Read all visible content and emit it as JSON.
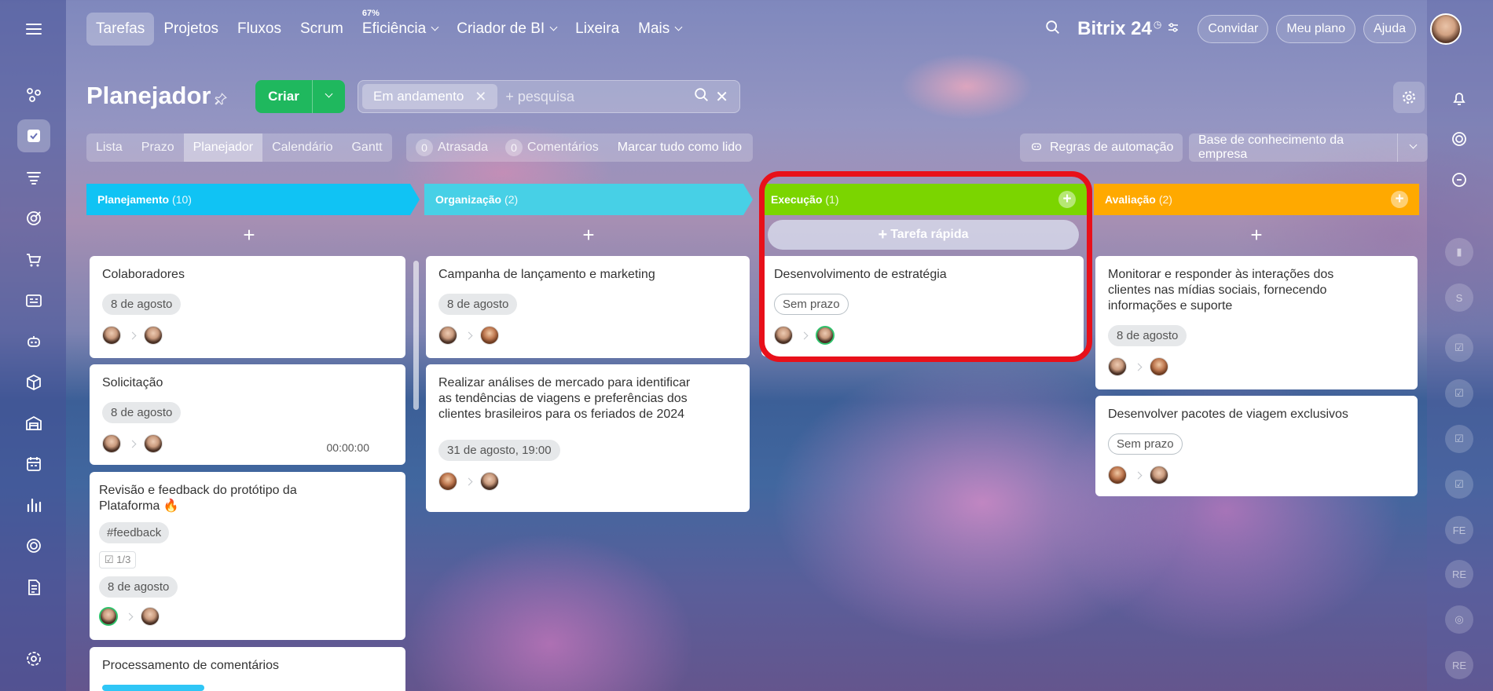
{
  "nav": {
    "items": [
      {
        "label": "Tarefas",
        "active": true
      },
      {
        "label": "Projetos"
      },
      {
        "label": "Fluxos"
      },
      {
        "label": "Scrum"
      },
      {
        "label": "Eficiência",
        "badge": "67%",
        "dropdown": true
      },
      {
        "label": "Criador de BI",
        "dropdown": true
      },
      {
        "label": "Lixeira"
      },
      {
        "label": "Mais",
        "dropdown": true
      }
    ],
    "logo": "Bitrix 24",
    "invite": "Convidar",
    "plan": "Meu plano",
    "help": "Ajuda"
  },
  "page": {
    "title": "Planejador",
    "create": "Criar",
    "filter_chip": "Em andamento",
    "search_placeholder": "+ pesquisa"
  },
  "views": [
    "Lista",
    "Prazo",
    "Planejador",
    "Calendário",
    "Gantt"
  ],
  "active_view": "Planejador",
  "counters": {
    "overdue_count": "0",
    "overdue_label": "Atrasada",
    "comments_count": "0",
    "comments_label": "Comentários",
    "mark_all": "Marcar tudo como lido"
  },
  "automation": "Regras de automação",
  "knowledge_base": "Base de conhecimento da empresa",
  "quick_task": "Tarefa rápida",
  "columns": [
    {
      "name": "Planejamento",
      "count": "(10)",
      "color": "#10c3f4"
    },
    {
      "name": "Organização",
      "count": "(2)",
      "color": "#47d0e6"
    },
    {
      "name": "Execução",
      "count": "(1)",
      "color": "#7bd500"
    },
    {
      "name": "Avaliação",
      "count": "(2)",
      "color": "#ffa900"
    }
  ],
  "cards": {
    "c1": {
      "title": "Colaboradores",
      "date": "8 de agosto"
    },
    "c2": {
      "title": "Solicitação",
      "date": "8 de agosto",
      "timer": "00:00:00"
    },
    "c3": {
      "title": "Revisão e feedback do protótipo da Plataforma",
      "tag": "#feedback",
      "checklist": "1/3",
      "date": "8 de agosto"
    },
    "c4": {
      "title": "Processamento de comentários"
    },
    "o1": {
      "title": "Campanha de lançamento e marketing",
      "date": "8 de agosto"
    },
    "o2": {
      "title": "Realizar análises de mercado para identificar as tendências de viagens e preferências dos clientes brasileiros para os feriados de 2024",
      "date": "31 de agosto, 19:00"
    },
    "e1": {
      "title": "Desenvolvimento de estratégia",
      "date": "Sem prazo"
    },
    "a1": {
      "title": "Monitorar e responder às interações dos clientes nas mídias sociais, fornecendo informações e suporte",
      "date": "8 de agosto"
    },
    "a2": {
      "title": "Desenvolver pacotes de viagem exclusivos",
      "date": "Sem prazo"
    }
  },
  "right_bar": [
    "S",
    "FE",
    "RE",
    "RE"
  ],
  "icons": {
    "left": [
      "menu-icon",
      "projects-icon",
      "tasks-icon",
      "filter-icon",
      "target-icon",
      "cart-icon",
      "news-icon",
      "robot-icon",
      "box-icon",
      "warehouse-icon",
      "calendar-icon",
      "chart-icon",
      "circle-icon",
      "document-icon",
      "settings-icon"
    ]
  }
}
